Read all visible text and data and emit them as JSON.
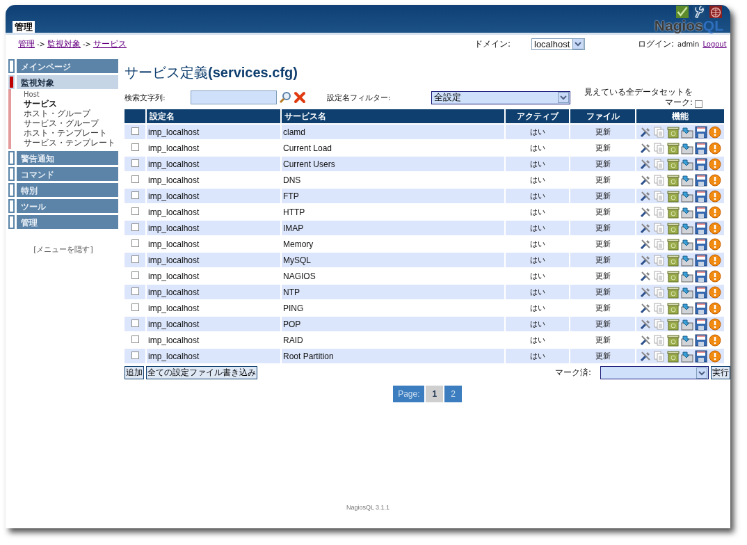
{
  "header": {
    "tab": "管理",
    "logo": {
      "main": "Nagios",
      "accent": "QL"
    }
  },
  "breadcrumb": [
    "管理",
    "監視対象",
    "サービス"
  ],
  "breadcrumb_separator": "->",
  "domain": {
    "label": "ドメイン:",
    "value": "localhost"
  },
  "login": {
    "label": "ログイン:",
    "user": "admin",
    "logout": "Logout"
  },
  "sidebar": {
    "items": [
      {
        "label": "メインページ",
        "selected": false
      },
      {
        "label": "監視対象",
        "selected": true,
        "children": [
          {
            "label": "Host",
            "kind": "note",
            "selected": false
          },
          {
            "label": "サービス",
            "kind": "link",
            "selected": true
          },
          {
            "label": "ホスト・グループ",
            "kind": "link",
            "selected": false
          },
          {
            "label": "サービス・グループ",
            "kind": "link",
            "selected": false
          },
          {
            "label": "ホスト・テンプレート",
            "kind": "link",
            "selected": false
          },
          {
            "label": "サービス・テンプレート",
            "kind": "link",
            "selected": false
          }
        ]
      },
      {
        "label": "警告通知",
        "selected": false
      },
      {
        "label": "コマンド",
        "selected": false
      },
      {
        "label": "特別",
        "selected": false
      },
      {
        "label": "ツール",
        "selected": false
      },
      {
        "label": "管理",
        "selected": false
      }
    ],
    "hide_menu": "[メニューを隠す]"
  },
  "title": {
    "main": "サービス定義",
    "file": "(services.cfg)"
  },
  "search": {
    "label": "検索文字列:"
  },
  "filter": {
    "label": "設定名フィルター:",
    "value": "全設定"
  },
  "mark_all": {
    "label": "見えている全データセットをマーク:",
    "checked": false
  },
  "table": {
    "columns": [
      "設定名",
      "サービス名",
      "アクティブ",
      "ファイル",
      "機能"
    ],
    "rows": [
      {
        "config": "imp_localhost",
        "service": "clamd",
        "active": "はい",
        "file": "更新",
        "checked": false
      },
      {
        "config": "imp_localhost",
        "service": "Current Load",
        "active": "はい",
        "file": "更新",
        "checked": false
      },
      {
        "config": "imp_localhost",
        "service": "Current Users",
        "active": "はい",
        "file": "更新",
        "checked": false
      },
      {
        "config": "imp_localhost",
        "service": "DNS",
        "active": "はい",
        "file": "更新",
        "checked": false
      },
      {
        "config": "imp_localhost",
        "service": "FTP",
        "active": "はい",
        "file": "更新",
        "checked": false
      },
      {
        "config": "imp_localhost",
        "service": "HTTP",
        "active": "はい",
        "file": "更新",
        "checked": false
      },
      {
        "config": "imp_localhost",
        "service": "IMAP",
        "active": "はい",
        "file": "更新",
        "checked": false
      },
      {
        "config": "imp_localhost",
        "service": "Memory",
        "active": "はい",
        "file": "更新",
        "checked": false
      },
      {
        "config": "imp_localhost",
        "service": "MySQL",
        "active": "はい",
        "file": "更新",
        "checked": false
      },
      {
        "config": "imp_localhost",
        "service": "NAGIOS",
        "active": "はい",
        "file": "更新",
        "checked": false
      },
      {
        "config": "imp_localhost",
        "service": "NTP",
        "active": "はい",
        "file": "更新",
        "checked": false
      },
      {
        "config": "imp_localhost",
        "service": "PING",
        "active": "はい",
        "file": "更新",
        "checked": false
      },
      {
        "config": "imp_localhost",
        "service": "POP",
        "active": "はい",
        "file": "更新",
        "checked": false
      },
      {
        "config": "imp_localhost",
        "service": "RAID",
        "active": "はい",
        "file": "更新",
        "checked": false
      },
      {
        "config": "imp_localhost",
        "service": "Root Partition",
        "active": "はい",
        "file": "更新",
        "checked": false
      }
    ]
  },
  "actions": {
    "add": "追加",
    "write_all": "全ての設定ファイル書き込み",
    "marked_label": "マーク済:",
    "run": "実行"
  },
  "pagination": {
    "label": "Page:",
    "pages": [
      {
        "label": "1",
        "selected": true
      },
      {
        "label": "2",
        "selected": false
      }
    ]
  },
  "footer": "NagiosQL 3.1.1"
}
